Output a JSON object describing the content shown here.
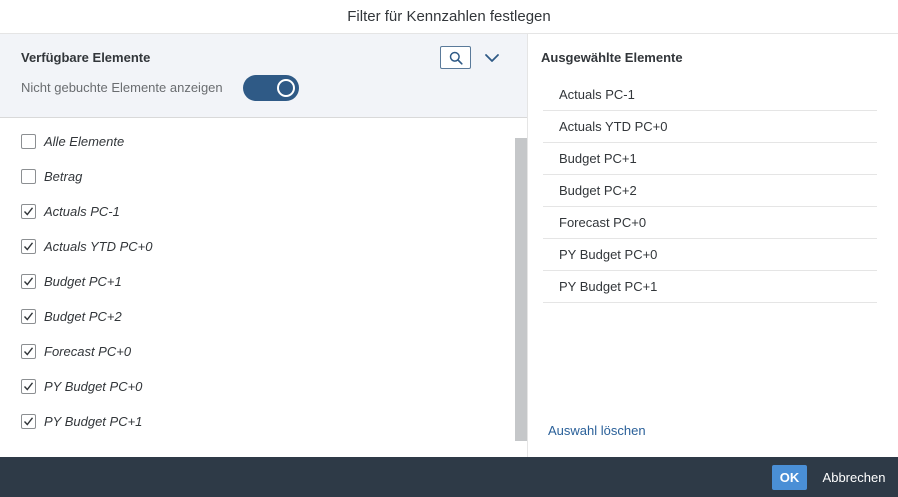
{
  "dialog": {
    "title": "Filter für Kennzahlen festlegen"
  },
  "available": {
    "title": "Verfügbare Elemente",
    "toggle_label": "Nicht gebuchte Elemente anzeigen",
    "toggle_on": true,
    "search_icon": "search-icon",
    "expand_icon": "chevron-down-icon",
    "items": [
      {
        "label": "Alle Elemente",
        "checked": false
      },
      {
        "label": "Betrag",
        "checked": false
      },
      {
        "label": "Actuals PC-1",
        "checked": true
      },
      {
        "label": "Actuals YTD PC+0",
        "checked": true
      },
      {
        "label": "Budget PC+1",
        "checked": true
      },
      {
        "label": "Budget PC+2",
        "checked": true
      },
      {
        "label": "Forecast PC+0",
        "checked": true
      },
      {
        "label": "PY Budget PC+0",
        "checked": true
      },
      {
        "label": "PY Budget PC+1",
        "checked": true
      }
    ]
  },
  "selected": {
    "title": "Ausgewählte Elemente",
    "items": [
      "Actuals PC-1",
      "Actuals YTD PC+0",
      "Budget PC+1",
      "Budget PC+2",
      "Forecast PC+0",
      "PY Budget PC+0",
      "PY Budget PC+1"
    ],
    "clear_label": "Auswahl löschen"
  },
  "footer": {
    "ok_label": "OK",
    "cancel_label": "Abbrechen"
  },
  "colors": {
    "accent": "#2f5a86",
    "ok_button": "#4a8fd6",
    "footer_bg": "#2e3a47",
    "link": "#2a6099"
  }
}
